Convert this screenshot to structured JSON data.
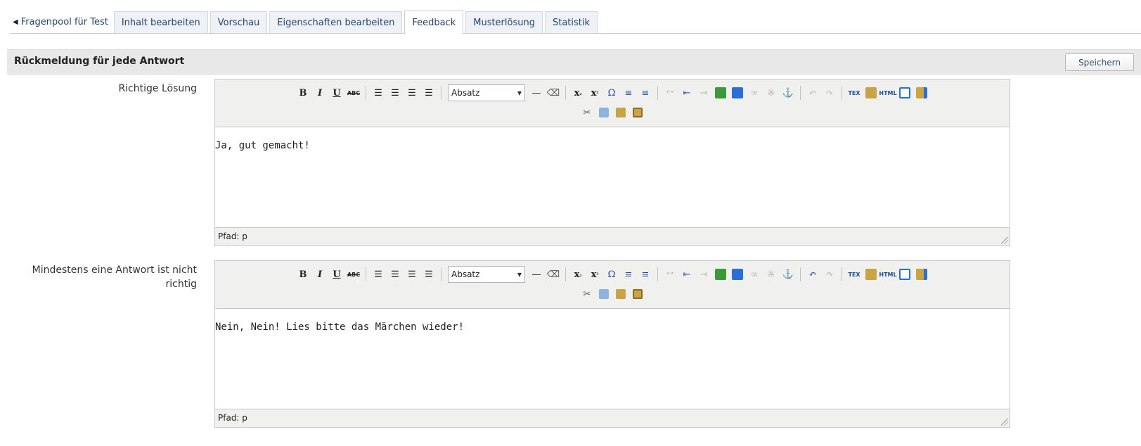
{
  "tabs": {
    "back": "Fragenpool für Test",
    "items": [
      {
        "label": "Inhalt bearbeiten"
      },
      {
        "label": "Vorschau"
      },
      {
        "label": "Eigenschaften bearbeiten"
      },
      {
        "label": "Feedback",
        "active": true
      },
      {
        "label": "Musterlösung"
      },
      {
        "label": "Statistik"
      }
    ]
  },
  "section": {
    "title": "Rückmeldung für jede Antwort",
    "save_label": "Speichern"
  },
  "editor_toolbar": {
    "format_value": "Absatz",
    "icons": [
      "bold-icon",
      "italic-icon",
      "underline-icon",
      "strikethrough-icon",
      "align-left-icon",
      "align-center-icon",
      "align-right-icon",
      "align-justify-icon",
      "horizontal-rule-icon",
      "remove-format-icon",
      "subscript-icon",
      "superscript-icon",
      "special-char-icon",
      "bullet-list-icon",
      "numbered-list-icon",
      "blockquote-icon",
      "outdent-icon",
      "indent-icon",
      "image-icon",
      "media-icon",
      "link-icon",
      "unlink-icon",
      "anchor-icon",
      "undo-icon",
      "redo-icon",
      "tex-icon",
      "paste-special-icon",
      "html-icon",
      "fullscreen-icon",
      "paste-word-icon",
      "cut-icon",
      "copy-icon",
      "paste-icon",
      "paste-text-icon"
    ]
  },
  "fields": [
    {
      "label": "Richtige Lösung",
      "content": "Ja, gut gemacht!",
      "path_label": "Pfad: p"
    },
    {
      "label": "Mindestens eine Antwort ist nicht richtig",
      "content": "Nein, Nein! Lies bitte das Märchen wieder!",
      "path_label": "Pfad: p"
    }
  ]
}
